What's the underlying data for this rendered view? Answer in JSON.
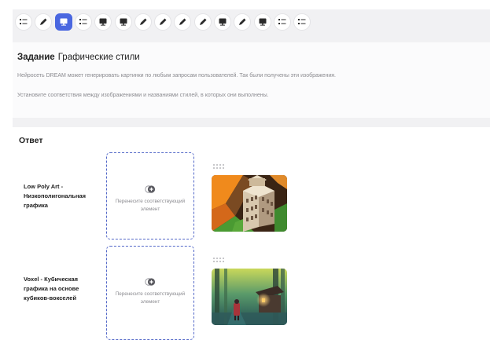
{
  "toolbar": {
    "buttons": [
      {
        "icon": "list-icon",
        "active": false
      },
      {
        "icon": "pen-icon",
        "active": false
      },
      {
        "icon": "monitor-icon",
        "active": true
      },
      {
        "icon": "list-icon",
        "active": false
      },
      {
        "icon": "monitor-icon",
        "active": false
      },
      {
        "icon": "monitor-icon",
        "active": false
      },
      {
        "icon": "pen-icon",
        "active": false
      },
      {
        "icon": "pen-icon",
        "active": false
      },
      {
        "icon": "pen-icon",
        "active": false
      },
      {
        "icon": "pen-icon",
        "active": false
      },
      {
        "icon": "monitor-icon",
        "active": false
      },
      {
        "icon": "pen-icon",
        "active": false
      },
      {
        "icon": "monitor-icon",
        "active": false
      },
      {
        "icon": "list-icon",
        "active": false
      },
      {
        "icon": "list-icon",
        "active": false
      }
    ],
    "colors": {
      "active": "#4a67e0",
      "icon": "#2b2b2b",
      "active_icon": "#ffffff"
    }
  },
  "task": {
    "label": "Задание",
    "title": "Графические стили",
    "line1": "Нейросеть DREAM может генерировать картинки по любым запросам пользователей. Так были получены эти изображения.",
    "line2": "Установите соответствия между изображениями и названиями стилей, в которых они выполнены."
  },
  "answer": {
    "label": "Ответ",
    "rows": [
      {
        "style": "Low Poly Art - Низкополигональная графика",
        "dropzone_text": "Перенесите соответствующий элемент",
        "image": "isometric-voxel-building-image"
      },
      {
        "style": "Voxel - Кубическая графика на основе кубиков-вокселей",
        "dropzone_text": "Перенесите соответствующий элемент",
        "image": "forest-lantern-figure-image"
      }
    ]
  }
}
